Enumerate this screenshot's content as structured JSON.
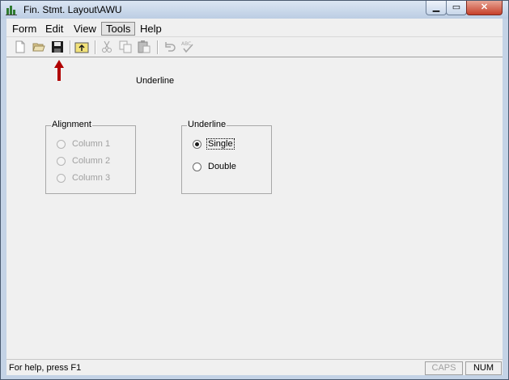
{
  "window": {
    "title": "Fin. Stmt. Layout\\AWU"
  },
  "menubar": {
    "items": [
      "Form",
      "Edit",
      "View",
      "Tools",
      "Help"
    ],
    "active": "Tools"
  },
  "toolbar": {
    "buttons": [
      "new-file-icon",
      "open-folder-icon",
      "save-icon",
      "folder-up-icon",
      "cut-icon",
      "copy-icon",
      "paste-icon",
      "undo-icon",
      "spell-check-icon"
    ],
    "spell_check_glyph": "ABC"
  },
  "annotation": {
    "arrow_color": "#b00000",
    "points_to": "save-icon"
  },
  "main": {
    "heading": "Underline",
    "alignment_group": {
      "title": "Alignment",
      "options": [
        "Column 1",
        "Column 2",
        "Column 3"
      ],
      "enabled": false
    },
    "underline_group": {
      "title": "Underline",
      "options": [
        "Single",
        "Double"
      ],
      "selected": "Single"
    }
  },
  "statusbar": {
    "help_text": "For help, press F1",
    "caps": "CAPS",
    "num": "NUM"
  }
}
